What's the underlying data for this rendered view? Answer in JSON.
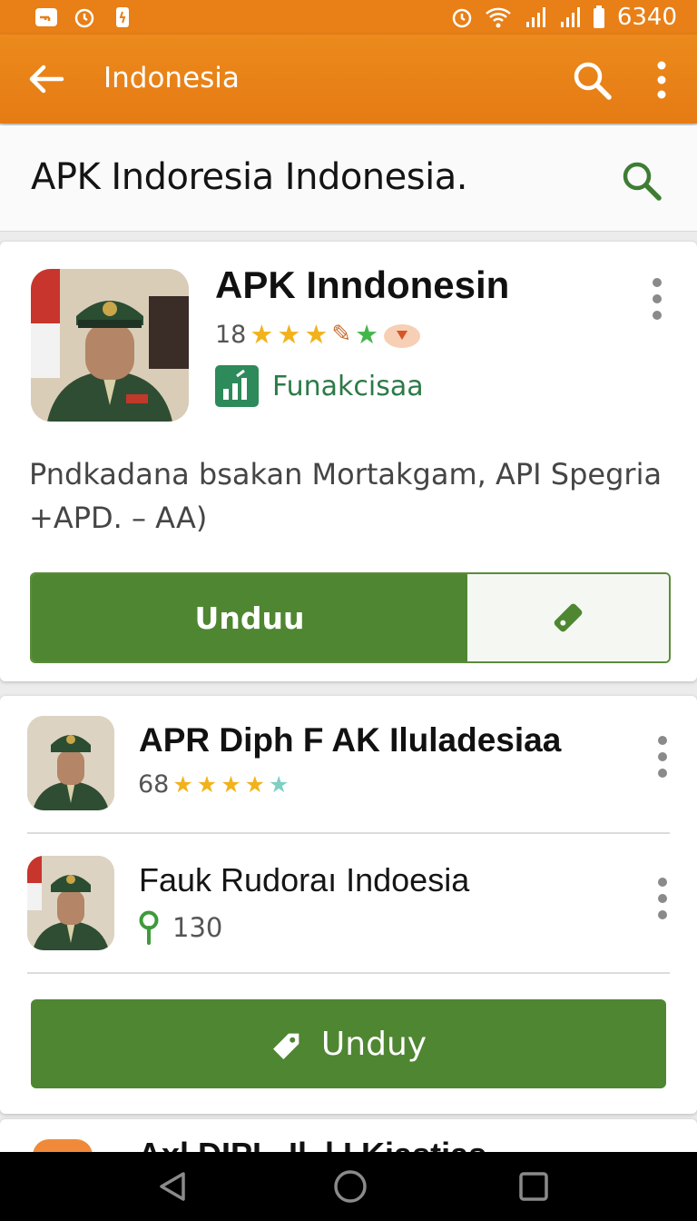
{
  "status_bar": {
    "time": "6340",
    "left_icons": [
      "key-icon",
      "alarm-icon",
      "battery-small-icon"
    ],
    "right_icons": [
      "alarm-icon",
      "wifi-icon",
      "signal-icon",
      "signal-icon",
      "battery-icon"
    ]
  },
  "app_bar": {
    "title": "Indonesia",
    "icons": [
      "back-arrow-icon",
      "search-icon",
      "more-vert-icon"
    ],
    "color": "#e87f17"
  },
  "search": {
    "query": "APK Indoresia Indonesia."
  },
  "featured": {
    "title": "APK Inndonesin",
    "rating_count": "18",
    "rating_stars": 4,
    "category": "Funakcisaa",
    "description": "Pndkadana bsakan Mortakgam, API Spegria +APD. – AA)",
    "download_label": "Unduu"
  },
  "list": [
    {
      "title": "APR Diph F AK Iluladesiaa",
      "rating_count": "68",
      "rating_stars": 4.5
    },
    {
      "title": "Fauk Rudoraı Indoesia",
      "count": "130"
    }
  ],
  "download_all_label": "Unduy",
  "partial_item": {
    "title": "Axl DIPI ..Il..l  I Kiastias"
  },
  "colors": {
    "accent": "#e87f17",
    "primary_green": "#4f8632",
    "star": "#f2b21c"
  },
  "nav_bar": {
    "icons": [
      "back-triangle-icon",
      "home-circle-icon",
      "recents-square-icon"
    ]
  }
}
